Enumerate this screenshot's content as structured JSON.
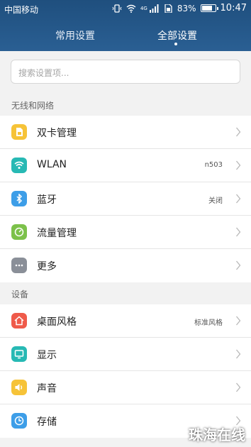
{
  "status": {
    "carrier": "中国移动",
    "network": "4G",
    "battery": "83%",
    "battery_level": 0.83,
    "time": "10:47"
  },
  "tabs": [
    {
      "label": "常用设置"
    },
    {
      "label": "全部设置"
    }
  ],
  "search": {
    "placeholder": "搜索设置项..."
  },
  "sections": [
    {
      "title": "无线和网络",
      "items": [
        {
          "label": "双卡管理",
          "value": "",
          "icon": "dual-sim-icon",
          "color": "#f6c338"
        },
        {
          "label": "WLAN",
          "value": "n503",
          "icon": "wifi-icon",
          "color": "#27b9b4"
        },
        {
          "label": "蓝牙",
          "value": "关闭",
          "icon": "bluetooth-icon",
          "color": "#3d9ee8"
        },
        {
          "label": "流量管理",
          "value": "",
          "icon": "data-usage-icon",
          "color": "#7cc14a"
        },
        {
          "label": "更多",
          "value": "",
          "icon": "more-icon",
          "color": "#8a8f98"
        }
      ]
    },
    {
      "title": "设备",
      "items": [
        {
          "label": "桌面风格",
          "value": "标准风格",
          "icon": "home-style-icon",
          "color": "#ef5a4a"
        },
        {
          "label": "显示",
          "value": "",
          "icon": "display-icon",
          "color": "#27b9b4"
        },
        {
          "label": "声音",
          "value": "",
          "icon": "sound-icon",
          "color": "#f6c338"
        },
        {
          "label": "存储",
          "value": "",
          "icon": "storage-icon",
          "color": "#3d9ee8"
        }
      ]
    }
  ],
  "watermark": "珠海在线"
}
